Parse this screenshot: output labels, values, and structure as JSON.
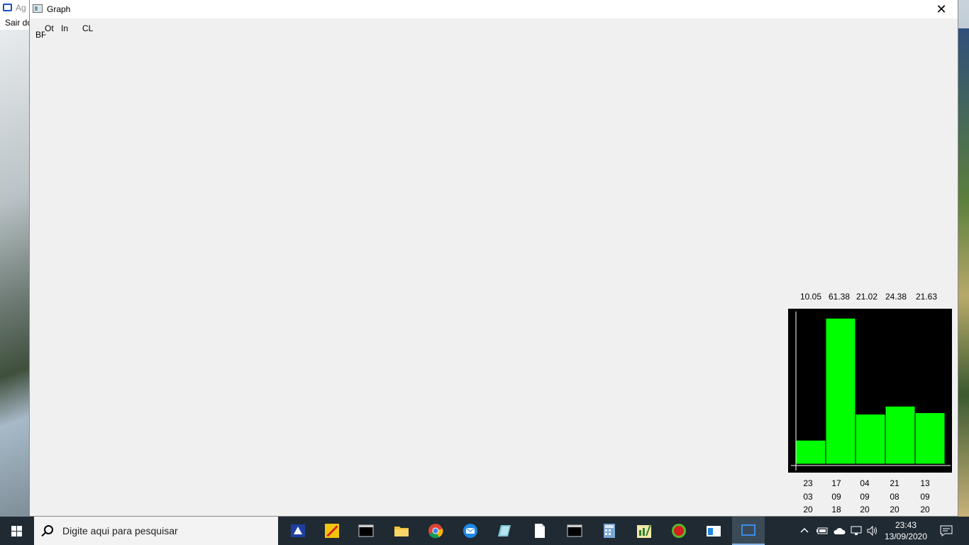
{
  "background_window": {
    "title": "Ag",
    "menu": "Sair do"
  },
  "window": {
    "title": "Graph",
    "close_glyph": "✕"
  },
  "labels": {
    "bf": "BF",
    "ot": "Ot",
    "in": "In",
    "cl": "CL"
  },
  "chart_data": {
    "type": "bar",
    "categories": [
      "23 03 20",
      "17 09 18",
      "04 09 20",
      "21 08 20",
      "13 09 20"
    ],
    "values": [
      10.05,
      61.38,
      21.02,
      24.38,
      21.63
    ],
    "value_labels": [
      "10.05",
      "61.38",
      "21.02",
      "24.38",
      "21.63"
    ],
    "date_lines": [
      [
        "23",
        "03",
        "20"
      ],
      [
        "17",
        "09",
        "18"
      ],
      [
        "04",
        "09",
        "20"
      ],
      [
        "21",
        "08",
        "20"
      ],
      [
        "13",
        "09",
        "20"
      ]
    ],
    "ylim": [
      0,
      63
    ],
    "bar_color": "#00ff00",
    "background_color": "#000000",
    "grid": false
  },
  "taskbar": {
    "search_placeholder": "Digite aqui para pesquisar",
    "time": "23:43",
    "date": "13/09/2020",
    "accent": "#1f2a33"
  }
}
